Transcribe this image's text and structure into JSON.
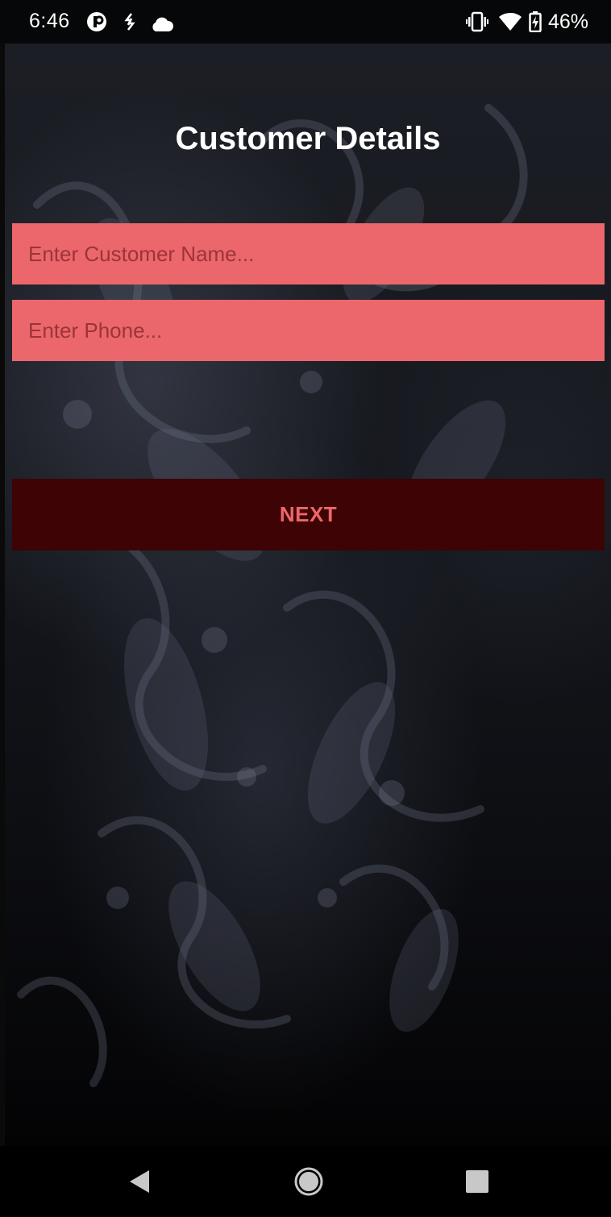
{
  "status_bar": {
    "time": "6:46",
    "battery_percent": "46%",
    "icons": [
      "pocket-casts-icon",
      "sync-icon",
      "cloud-icon",
      "vibrate-icon",
      "wifi-icon",
      "battery-charging-icon"
    ]
  },
  "page": {
    "title": "Customer Details"
  },
  "form": {
    "name_placeholder": "Enter Customer Name...",
    "phone_placeholder": "Enter Phone...",
    "next_label": "NEXT"
  },
  "nav_bar": {
    "icons": [
      "back-icon",
      "home-icon",
      "recents-icon"
    ]
  },
  "colors": {
    "field_bg": "#ec676b",
    "button_bg": "#3e0305",
    "button_text": "#ec676b",
    "title_text": "#ffffff"
  }
}
